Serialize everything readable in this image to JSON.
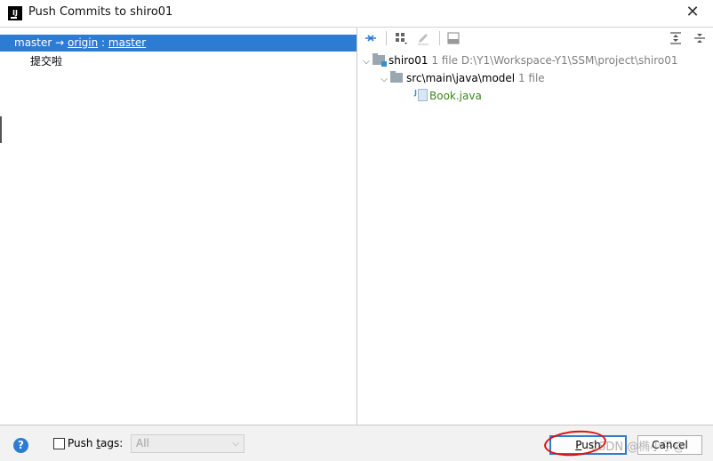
{
  "window": {
    "title": "Push Commits to shiro01",
    "app_icon_text": "IJ"
  },
  "left": {
    "branch": {
      "local": "master",
      "arrow": "→",
      "remote": "origin",
      "separator": ":",
      "target": "master"
    },
    "commits": [
      "提交啦"
    ]
  },
  "right": {
    "tree": {
      "root": {
        "name": "shiro01",
        "count": "1 file",
        "path": "D:\\Y1\\Workspace-Y1\\SSM\\project\\shiro01"
      },
      "folder": {
        "name": "src\\main\\java\\model",
        "count": "1 file"
      },
      "file": {
        "name": "Book.java"
      }
    }
  },
  "footer": {
    "help": "?",
    "push_tags_label_underlined": "Push ",
    "push_tags_label_accel": "t",
    "push_tags_label_rest": "ags:",
    "tags_value": "All",
    "push_accel": "P",
    "push_rest": "ush",
    "cancel_label": "Cancel",
    "watermark": "CSDN @椭小子@"
  },
  "colors": {
    "selection": "#2d7cd4",
    "file_added": "#3a8a1e",
    "annotation": "#e01010"
  }
}
